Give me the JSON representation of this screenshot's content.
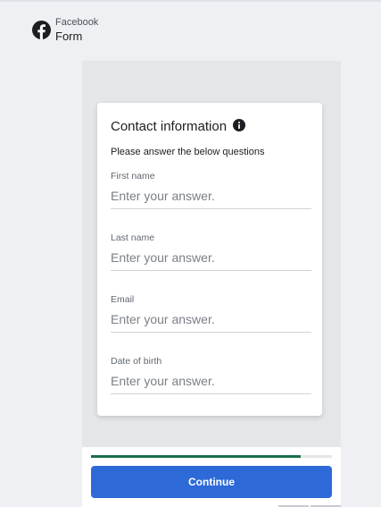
{
  "header": {
    "brand": "Facebook",
    "title": "Form",
    "logo_icon": "facebook-logo-icon"
  },
  "form": {
    "title": "Contact information",
    "info_icon": "info-icon",
    "subtitle": "Please answer the below questions",
    "fields": [
      {
        "label": "First name",
        "placeholder": "Enter your answer.",
        "value": ""
      },
      {
        "label": "Last name",
        "placeholder": "Enter your answer.",
        "value": ""
      },
      {
        "label": "Email",
        "placeholder": "Enter your answer.",
        "value": ""
      },
      {
        "label": "Date of birth",
        "placeholder": "Enter your answer.",
        "value": ""
      }
    ]
  },
  "footer": {
    "progress": 0.87,
    "continue_label": "Continue"
  },
  "colors": {
    "page_background": "#eef0f3",
    "panel_background": "#e4e6e9",
    "accent_button": "#2d6ad8",
    "progress": "#1a6f4a"
  }
}
